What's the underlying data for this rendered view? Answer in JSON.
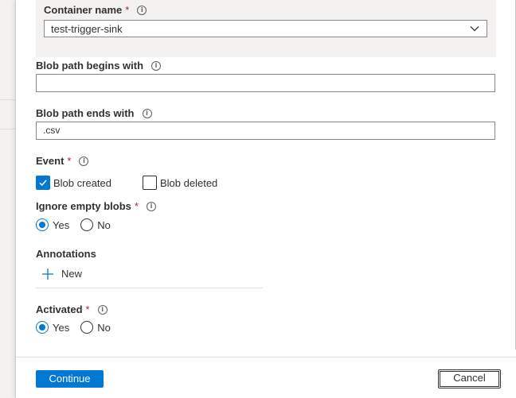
{
  "container": {
    "label": "Container name",
    "required_mark": "*",
    "value": "test-trigger-sink"
  },
  "blob_begins": {
    "label": "Blob path begins with",
    "value": ""
  },
  "blob_ends": {
    "label": "Blob path ends with",
    "value": ".csv"
  },
  "event": {
    "label": "Event",
    "required_mark": "*",
    "options": [
      {
        "label": "Blob created",
        "checked": true
      },
      {
        "label": "Blob deleted",
        "checked": false
      }
    ]
  },
  "ignore_empty": {
    "label": "Ignore empty blobs",
    "required_mark": "*",
    "options": [
      {
        "label": "Yes",
        "selected": true
      },
      {
        "label": "No",
        "selected": false
      }
    ]
  },
  "annotations": {
    "label": "Annotations",
    "new_label": "New"
  },
  "activated": {
    "label": "Activated",
    "required_mark": "*",
    "options": [
      {
        "label": "Yes",
        "selected": true
      },
      {
        "label": "No",
        "selected": false
      }
    ]
  },
  "footer": {
    "continue_label": "Continue",
    "cancel_label": "Cancel"
  },
  "colors": {
    "accent": "#0078d4",
    "required": "#a4262c"
  },
  "icons": {
    "info": "info-circle-icon",
    "chevron": "chevron-down-icon",
    "check": "checkmark-icon",
    "plus": "plus-icon"
  }
}
